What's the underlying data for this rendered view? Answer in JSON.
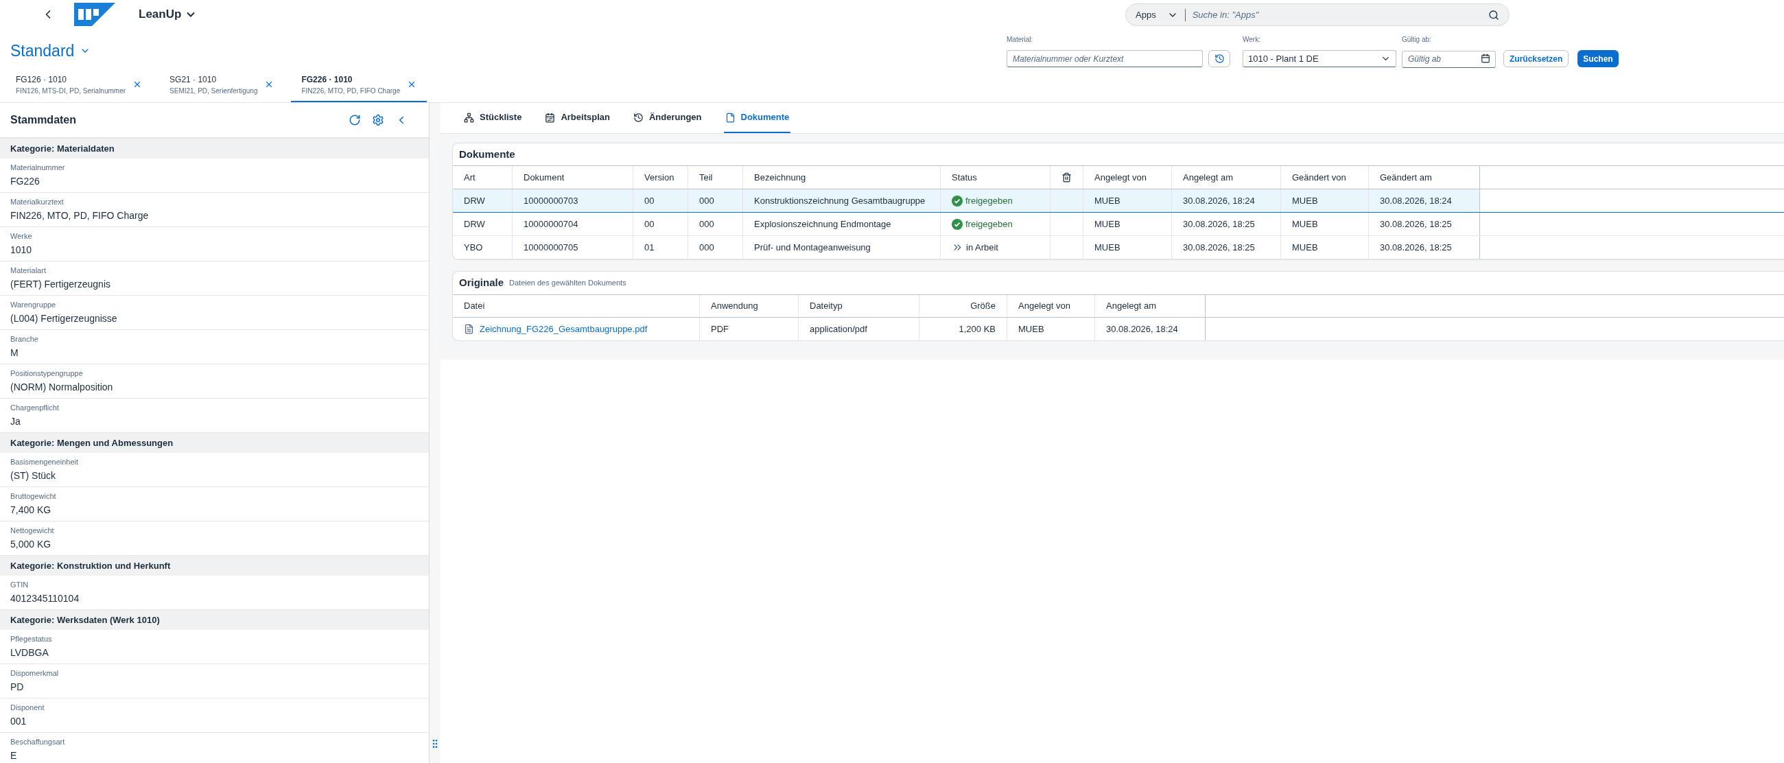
{
  "shell": {
    "title": "LeanUp",
    "search": {
      "scope": "Apps",
      "placeholder": "Suche in: \"Apps\""
    }
  },
  "variant": {
    "title": "Standard"
  },
  "filters": {
    "material": {
      "label": "Material:",
      "placeholder": "Materialnummer oder Kurztext"
    },
    "werk": {
      "label": "Werk:",
      "value": "1010 - Plant 1 DE"
    },
    "valid_from": {
      "label": "Gültig ab:",
      "placeholder": "Gültig ab"
    },
    "buttons": [
      {
        "label": "Zurücksetzen",
        "kind": "secondary"
      },
      {
        "label": "Suchen",
        "kind": "primary"
      }
    ]
  },
  "object_tabs": [
    {
      "title": "FG126 · 1010",
      "subtitle": "FIN126, MTS-DI, PD, Serialnummer",
      "selected": false
    },
    {
      "title": "SG21 · 1010",
      "subtitle": "SEMI21, PD, Serienfertigung",
      "selected": false
    },
    {
      "title": "FG226 · 1010",
      "subtitle": "FIN226, MTO, PD, FIFO Charge",
      "selected": true
    }
  ],
  "master_data": {
    "title": "Stammdaten",
    "sections": [
      {
        "title": "Kategorie: Materialdaten",
        "fields": [
          {
            "label": "Materialnummer",
            "value": "FG226"
          },
          {
            "label": "Materialkurztext",
            "value": "FIN226, MTO, PD, FIFO Charge"
          },
          {
            "label": "Werke",
            "value": "1010"
          },
          {
            "label": "Materialart",
            "value": "(FERT) Fertigerzeugnis"
          },
          {
            "label": "Warengruppe",
            "value": "(L004) Fertigerzeugnisse"
          },
          {
            "label": "Branche",
            "value": "M"
          },
          {
            "label": "Positionstypengruppe",
            "value": "(NORM) Normalposition"
          },
          {
            "label": "Chargenpflicht",
            "value": "Ja"
          }
        ]
      },
      {
        "title": "Kategorie: Mengen und Abmessungen",
        "fields": [
          {
            "label": "Basismengeneinheit",
            "value": "(ST) Stück"
          },
          {
            "label": "Bruttogewicht",
            "value": "7,400 KG"
          },
          {
            "label": "Nettogewicht",
            "value": "5,000 KG"
          }
        ]
      },
      {
        "title": "Kategorie: Konstruktion und Herkunft",
        "fields": [
          {
            "label": "GTIN",
            "value": "4012345110104"
          }
        ]
      },
      {
        "title": "Kategorie: Werksdaten (Werk 1010)",
        "fields": [
          {
            "label": "Pflegestatus",
            "value": "LVDBGA"
          },
          {
            "label": "Dispomerkmal",
            "value": "PD"
          },
          {
            "label": "Disponent",
            "value": "001"
          },
          {
            "label": "Beschaffungsart",
            "value": "E"
          }
        ]
      }
    ]
  },
  "detail_tabs": [
    {
      "label": "Stückliste",
      "selected": false
    },
    {
      "label": "Arbeitsplan",
      "selected": false
    },
    {
      "label": "Änderungen",
      "selected": false
    },
    {
      "label": "Dokumente",
      "selected": true
    }
  ],
  "documents": {
    "title": "Dokumente",
    "columns": [
      {
        "kind": "text",
        "label": "Art"
      },
      {
        "kind": "text",
        "label": "Dokument"
      },
      {
        "kind": "text",
        "label": "Version"
      },
      {
        "kind": "text",
        "label": "Teil"
      },
      {
        "kind": "text",
        "label": "Bezeichnung"
      },
      {
        "kind": "text",
        "label": "Status"
      },
      {
        "kind": "delete"
      },
      {
        "kind": "text",
        "label": "Angelegt von"
      },
      {
        "kind": "text",
        "label": "Angelegt am"
      },
      {
        "kind": "text",
        "label": "Geändert von"
      },
      {
        "kind": "text",
        "label": "Geändert am"
      }
    ],
    "rows": [
      {
        "selected": true,
        "art": "DRW",
        "document": "10000000703",
        "version": "00",
        "part": "000",
        "description": "Konstruktionszeichnung Gesamtbaugruppe",
        "status": {
          "kind": "released",
          "text": "freigegeben"
        },
        "created_by": "MUEB",
        "created_at": "30.08.2026, 18:24",
        "changed_by": "MUEB",
        "changed_at": "30.08.2026, 18:24"
      },
      {
        "selected": false,
        "art": "DRW",
        "document": "10000000704",
        "version": "00",
        "part": "000",
        "description": "Explosionszeichnung Endmontage",
        "status": {
          "kind": "released",
          "text": "freigegeben"
        },
        "created_by": "MUEB",
        "created_at": "30.08.2026, 18:25",
        "changed_by": "MUEB",
        "changed_at": "30.08.2026, 18:25"
      },
      {
        "selected": false,
        "art": "YBO",
        "document": "10000000705",
        "version": "01",
        "part": "000",
        "description": "Prüf- und Montageanweisung",
        "status": {
          "kind": "in_progress",
          "text": "in Arbeit"
        },
        "created_by": "MUEB",
        "created_at": "30.08.2026, 18:25",
        "changed_by": "MUEB",
        "changed_at": "30.08.2026, 18:25"
      }
    ]
  },
  "originals": {
    "title": "Originale",
    "subtitle": "Dateien des gewählten Dokuments",
    "columns": [
      "Datei",
      "Anwendung",
      "Dateityp",
      "Größe",
      "Angelegt von",
      "Angelegt am"
    ],
    "rows": [
      {
        "file": "Zeichnung_FG226_Gesamtbaugruppe.pdf",
        "application": "PDF",
        "file_type": "application/pdf",
        "size": "1,200 KB",
        "created_by": "MUEB",
        "created_at": "30.08.2026, 18:24"
      }
    ]
  }
}
